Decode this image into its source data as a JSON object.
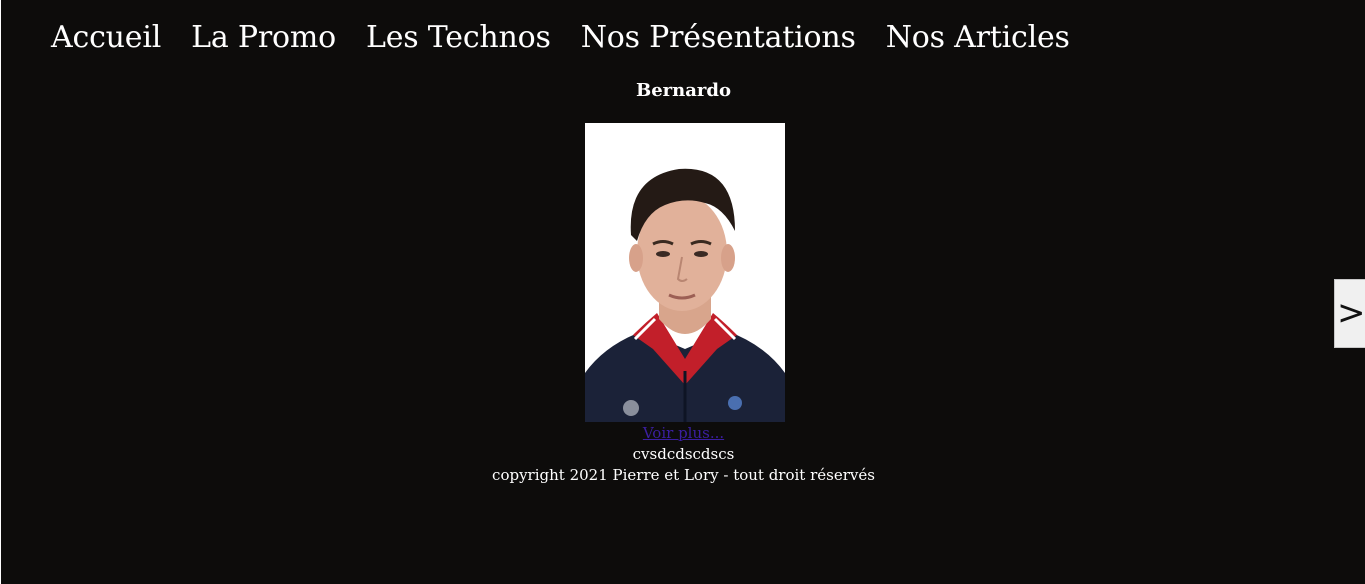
{
  "nav": {
    "items": [
      {
        "label": "Accueil"
      },
      {
        "label": "La Promo"
      },
      {
        "label": "Les Technos"
      },
      {
        "label": "Nos Présentations"
      },
      {
        "label": "Nos Articles"
      }
    ]
  },
  "profile": {
    "name": "Bernardo",
    "photo": "portrait-photo",
    "more_link": "Voir plus...",
    "description": "cvsdcdscdscs"
  },
  "footer": {
    "copyright": "copyright 2021 Pierre et Lory - tout droit réservés"
  },
  "carousel": {
    "next_label": ">"
  },
  "colors": {
    "background": "#0d0c0b",
    "text": "#ffffff",
    "link": "#3b1fa0",
    "button_bg": "#f0f0f0"
  }
}
